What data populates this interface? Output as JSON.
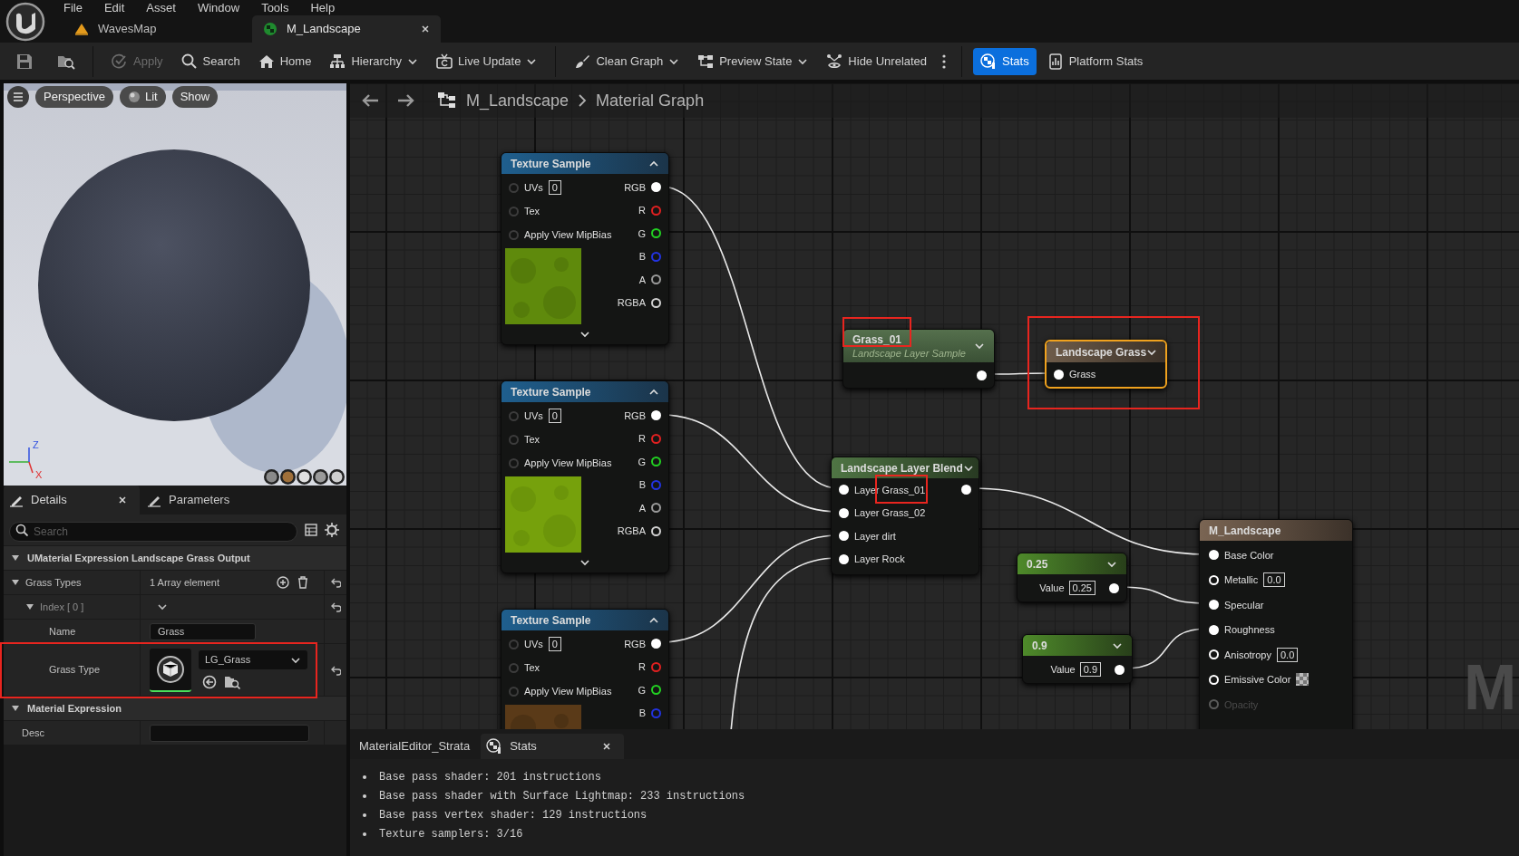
{
  "menu": [
    "File",
    "Edit",
    "Asset",
    "Window",
    "Tools",
    "Help"
  ],
  "document_tabs": [
    {
      "label": "WavesMap",
      "selected": false
    },
    {
      "label": "M_Landscape",
      "selected": true
    }
  ],
  "toolbar": [
    {
      "label": "Apply",
      "disabled": true,
      "dropdown": false,
      "selected": false
    },
    {
      "label": "Search",
      "disabled": false,
      "dropdown": false,
      "selected": false
    },
    {
      "label": "Home",
      "disabled": false,
      "dropdown": false,
      "selected": false
    },
    {
      "label": "Hierarchy",
      "disabled": false,
      "dropdown": true,
      "selected": false
    },
    {
      "label": "Live Update",
      "disabled": false,
      "dropdown": true,
      "selected": false
    },
    {
      "label": "Clean Graph",
      "disabled": false,
      "dropdown": true,
      "selected": false
    },
    {
      "label": "Preview State",
      "disabled": false,
      "dropdown": true,
      "selected": false
    },
    {
      "label": "Hide Unrelated",
      "disabled": false,
      "dropdown": false,
      "selected": false
    },
    {
      "label": "Stats",
      "disabled": false,
      "dropdown": false,
      "selected": true
    },
    {
      "label": "Platform Stats",
      "disabled": false,
      "dropdown": false,
      "selected": false
    }
  ],
  "viewport": {
    "buttons": [
      {
        "label": "Perspective"
      },
      {
        "label": "Lit"
      },
      {
        "label": "Show"
      }
    ],
    "axis_labels": [
      "Z",
      "X"
    ]
  },
  "details": {
    "tabs": [
      {
        "label": "Details",
        "selected": true
      },
      {
        "label": "Parameters",
        "selected": false
      }
    ],
    "search": {
      "placeholder": "Search"
    },
    "sections": [
      {
        "title": "UMaterial Expression Landscape Grass Output",
        "expanded": true,
        "rows": [
          {
            "kind": "array",
            "label": "Grass Types",
            "value": "1 Array element",
            "expanded": true,
            "highlighted": false
          },
          {
            "kind": "index",
            "label": "Index [ 0 ]",
            "expanded": true,
            "highlighted": false
          },
          {
            "kind": "text",
            "label": "Name",
            "value": "Grass",
            "highlighted": false
          },
          {
            "kind": "asset",
            "label": "Grass Type",
            "value": "LG_Grass",
            "highlighted": true
          }
        ]
      },
      {
        "title": "Material Expression",
        "expanded": true,
        "rows": [
          {
            "kind": "text",
            "label": "Desc",
            "highlighted": false
          }
        ]
      }
    ]
  },
  "graph": {
    "breadcrumb": [
      "M_Landscape",
      "Material Graph"
    ],
    "corner_label": "M",
    "nodes": [
      {
        "kind": "texture_sample",
        "title": "Texture Sample",
        "selected": false,
        "highlighted": false,
        "inputs": [
          {
            "label": "UVs",
            "value": "0"
          },
          {
            "label": "Tex"
          },
          {
            "label": "Apply View MipBias"
          }
        ],
        "outputs": [
          {
            "label": "RGB",
            "color": "#ffffff",
            "connected": true
          },
          {
            "label": "R",
            "color": "#e02020",
            "connected": false
          },
          {
            "label": "G",
            "color": "#22d022",
            "connected": false
          },
          {
            "label": "B",
            "color": "#2233e0",
            "connected": false
          },
          {
            "label": "A",
            "color": "#9a9a9a",
            "connected": false
          },
          {
            "label": "RGBA",
            "color": "#d0d0d0",
            "connected": false
          }
        ]
      },
      {
        "kind": "texture_sample",
        "title": "Texture Sample",
        "selected": false,
        "highlighted": false,
        "inputs": [
          {
            "label": "UVs",
            "value": "0"
          },
          {
            "label": "Tex"
          },
          {
            "label": "Apply View MipBias"
          }
        ],
        "outputs": [
          {
            "label": "RGB",
            "color": "#ffffff",
            "connected": true
          },
          {
            "label": "R",
            "color": "#e02020",
            "connected": false
          },
          {
            "label": "G",
            "color": "#22d022",
            "connected": false
          },
          {
            "label": "B",
            "color": "#2233e0",
            "connected": false
          },
          {
            "label": "A",
            "color": "#9a9a9a",
            "connected": false
          },
          {
            "label": "RGBA",
            "color": "#d0d0d0",
            "connected": false
          }
        ]
      },
      {
        "kind": "texture_sample",
        "title": "Texture Sample",
        "selected": false,
        "highlighted": false,
        "inputs": [
          {
            "label": "UVs",
            "value": "0"
          },
          {
            "label": "Tex"
          },
          {
            "label": "Apply View MipBias"
          }
        ],
        "outputs": [
          {
            "label": "RGB",
            "color": "#ffffff",
            "connected": true
          },
          {
            "label": "R",
            "color": "#e02020",
            "connected": false
          },
          {
            "label": "G",
            "color": "#22d022",
            "connected": false
          },
          {
            "label": "B",
            "color": "#2233e0",
            "connected": false
          }
        ]
      },
      {
        "kind": "layer_sample",
        "title": "Grass_01",
        "subtitle": "Landscape Layer Sample",
        "selected": false,
        "highlighted": true,
        "output_connected": true
      },
      {
        "kind": "grass_output",
        "title": "Landscape Grass",
        "selected": true,
        "highlighted": true,
        "inputs": [
          {
            "label": "Grass",
            "connected": true
          }
        ]
      },
      {
        "kind": "layer_blend",
        "title": "Landscape Layer Blend",
        "selected": false,
        "highlighted": false,
        "output_connected": true,
        "inputs": [
          {
            "label": "Layer Grass_01",
            "connected": true,
            "highlighted": true
          },
          {
            "label": "Layer Grass_02",
            "connected": true,
            "highlighted": false
          },
          {
            "label": "Layer dirt",
            "connected": true,
            "highlighted": false
          },
          {
            "label": "Layer Rock",
            "connected": true,
            "highlighted": false
          }
        ]
      },
      {
        "kind": "constant",
        "title": "0.25",
        "value_label": "Value",
        "value": "0.25",
        "selected": false,
        "highlighted": false,
        "output_connected": true
      },
      {
        "kind": "constant",
        "title": "0.9",
        "value_label": "Value",
        "value": "0.9",
        "selected": false,
        "highlighted": false,
        "output_connected": true
      },
      {
        "kind": "material_output",
        "title": "M_Landscape",
        "selected": false,
        "highlighted": false,
        "inputs": [
          {
            "label": "Base Color",
            "kind": "plain",
            "connected": true,
            "disabled": false
          },
          {
            "label": "Metallic",
            "kind": "number",
            "value": "0.0",
            "connected": false,
            "disabled": false
          },
          {
            "label": "Specular",
            "kind": "plain",
            "connected": true,
            "disabled": false
          },
          {
            "label": "Roughness",
            "kind": "plain",
            "connected": true,
            "disabled": false
          },
          {
            "label": "Anisotropy",
            "kind": "number",
            "value": "0.0",
            "connected": false,
            "disabled": false
          },
          {
            "label": "Emissive Color",
            "kind": "swatch",
            "connected": false,
            "disabled": false
          },
          {
            "label": "Opacity",
            "kind": "plain",
            "connected": false,
            "disabled": true
          }
        ]
      }
    ]
  },
  "stats_panel": {
    "tabs": [
      {
        "label": "MaterialEditor_Strata",
        "selected": false
      },
      {
        "label": "Stats",
        "selected": true
      }
    ],
    "lines": [
      "Base pass shader: 201 instructions",
      "Base pass shader with Surface Lightmap: 233 instructions",
      "Base pass vertex shader: 129 instructions",
      "Texture samplers: 3/16"
    ]
  }
}
